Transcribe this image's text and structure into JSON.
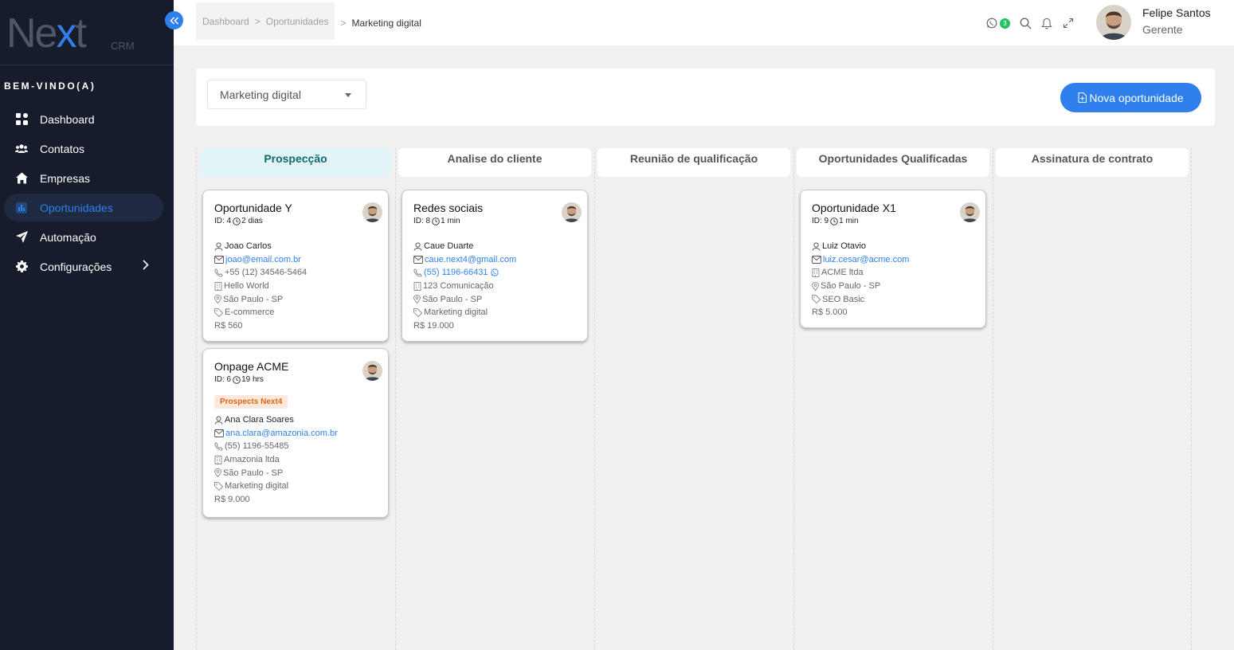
{
  "sidebar": {
    "logo_text_a": "Ne",
    "logo_text_x": "x",
    "logo_text_b": "t",
    "logo_sub": "CRM",
    "welcome": "BEM-VINDO(A)",
    "items": [
      {
        "label": "Dashboard",
        "icon": "grid-icon"
      },
      {
        "label": "Contatos",
        "icon": "users-icon"
      },
      {
        "label": "Empresas",
        "icon": "home-icon"
      },
      {
        "label": "Oportunidades",
        "icon": "chart-icon",
        "active": true
      },
      {
        "label": "Automação",
        "icon": "send-icon"
      },
      {
        "label": "Configurações",
        "icon": "gear-icon"
      }
    ]
  },
  "topbar": {
    "breadcrumb": [
      "Dashboard",
      "Oportunidades",
      "Marketing digital"
    ],
    "sep": ">",
    "whatsapp_count": "3",
    "user_name": "Felipe Santos",
    "user_role": "Gerente"
  },
  "filter": {
    "selected_pipeline": "Marketing digital",
    "new_button": "Nova oportunidade"
  },
  "columns": [
    {
      "title": "Prospecção"
    },
    {
      "title": "Analise do cliente"
    },
    {
      "title": "Reunião de qualificação"
    },
    {
      "title": "Oportunidades Qualificadas"
    },
    {
      "title": "Assinatura de contrato"
    }
  ],
  "cards": [
    {
      "title": "Oportunidade Y",
      "id": "ID: 4",
      "time": "2 dias",
      "contact": "Joao Carlos",
      "email": "joao@email.com.br",
      "phone": "+55 (12) 34546-5464",
      "company": "Hello World",
      "location": "São Paulo - SP",
      "category": "E-commerce",
      "value": "R$ 560"
    },
    {
      "title": "Onpage ACME",
      "id": "ID: 6",
      "time": "19 hrs",
      "tag": "Prospects Next4",
      "contact": "Ana Clara Soares",
      "email": "ana.clara@amazonia.com.br",
      "phone": "(55) 1196-55485",
      "company": "Amazonia ltda",
      "location": "São Paulo - SP",
      "category": "Marketing digital",
      "value": "R$ 9.000"
    },
    {
      "title": "Redes sociais",
      "id": "ID: 8",
      "time": "1 min",
      "contact": "Caue Duarte",
      "email": "caue.next4@gmail.com",
      "phone": "(55) 1196-66431",
      "company": "123 Comunicação",
      "location": "São Paulo - SP",
      "category": "Marketing digital",
      "value": "R$ 19.000"
    },
    {
      "title": "Oportunidade X1",
      "id": "ID: 9",
      "time": "1 min",
      "contact": "Luiz Otavio",
      "email": "luiz.cesar@acme.com",
      "company": "ACME ltda",
      "location": "São Paulo - SP",
      "category": "SEO Basic",
      "value": "R$ 5.000"
    }
  ],
  "colors": {
    "accent": "#2f80ed",
    "sidebar_bg": "#161c2b",
    "tag_bg": "#fde8dc",
    "tag_fg": "#e0641d",
    "whatsapp": "#25c25e"
  }
}
